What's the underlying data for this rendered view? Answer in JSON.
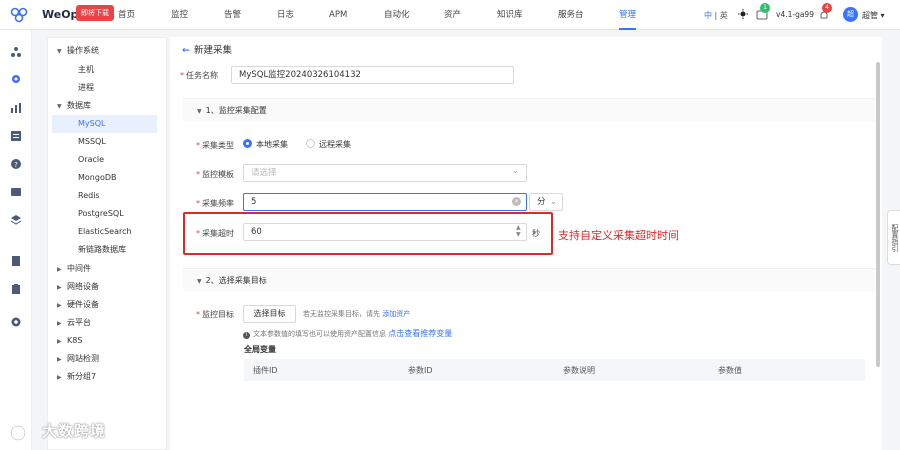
{
  "header": {
    "brand": "WeOps",
    "badge": "即将下载",
    "nav": [
      "首页",
      "监控",
      "告警",
      "日志",
      "APM",
      "自动化",
      "资产",
      "知识库",
      "服务台",
      "管理"
    ],
    "active_nav": "管理",
    "lang_current": "中",
    "lang_sep": "|",
    "lang_other": "英",
    "msg_count": "1",
    "version": "v4.1-ga99",
    "notice_count": "4",
    "avatar": "超",
    "user": "超管"
  },
  "tree": {
    "items": [
      {
        "label": "操作系统",
        "caret": "▼"
      },
      {
        "label": "主机"
      },
      {
        "label": "进程"
      },
      {
        "label": "数据库",
        "caret": "▼"
      },
      {
        "label": "MySQL"
      },
      {
        "label": "MSSQL"
      },
      {
        "label": "Oracle"
      },
      {
        "label": "MongoDB"
      },
      {
        "label": "Redis"
      },
      {
        "label": "PostgreSQL"
      },
      {
        "label": "ElasticSearch"
      },
      {
        "label": "新链路数据库"
      },
      {
        "label": "中间件",
        "caret": "▶"
      },
      {
        "label": "网络设备",
        "caret": "▶"
      },
      {
        "label": "硬件设备",
        "caret": "▶"
      },
      {
        "label": "云平台",
        "caret": "▶"
      },
      {
        "label": "K8S",
        "caret": "▶"
      },
      {
        "label": "网站检测",
        "caret": "▶"
      },
      {
        "label": "新分组7",
        "caret": "▶"
      }
    ]
  },
  "form": {
    "back_title": "新建采集",
    "task_name_label": "任务名称",
    "task_name_value": "MySQL监控20240326104132",
    "section1": "1、监控采集配置",
    "collect_type_label": "采集类型",
    "collect_type_local": "本地采集",
    "collect_type_remote": "远程采集",
    "template_label": "监控模板",
    "template_placeholder": "请选择",
    "freq_label": "采集频率",
    "freq_value": "5",
    "freq_unit": "分",
    "timeout_label": "采集超时",
    "timeout_value": "60",
    "timeout_unit": "秒",
    "annotation": "支持自定义采集超时时间",
    "section2": "2、选择采集目标",
    "target_label": "监控目标",
    "select_target_btn": "选择目标",
    "no_target_hint": "若无监控采集目标，请先",
    "add_asset_link": "添加资产",
    "info_hint": "文本参数值的填写也可以使用资产配置信息",
    "view_vars_link": "点击查看推荐变量",
    "global_vars_title": "全局变量",
    "global_vars_columns": [
      "插件ID",
      "参数ID",
      "参数说明",
      "参数值"
    ]
  },
  "sidetab": "配置指引",
  "watermark": "大数跨境",
  "icons": {
    "logo": "weops-logo-icon",
    "back": "back-arrow-icon",
    "theme": "sun-icon",
    "message": "message-icon",
    "notice": "bell-icon",
    "clear": "clear-icon",
    "dropdown": "chevron-down-icon",
    "spinner": "stepper-icon",
    "info": "info-icon"
  },
  "colors": {
    "accent": "#3a73ff",
    "highlight": "#e02a2a",
    "badge": "#e64545",
    "message_bubble": "#2fbf71"
  }
}
